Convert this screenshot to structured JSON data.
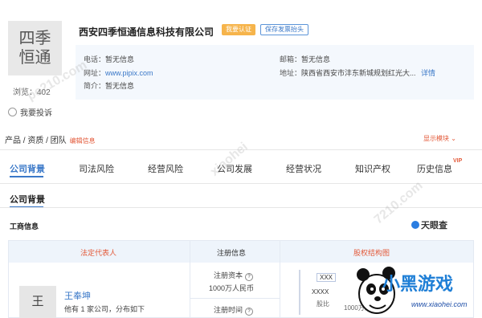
{
  "company": {
    "logo_text_line1": "四季",
    "logo_text_line2": "恒通",
    "name": "西安四季恒通信息科技有限公司",
    "cert_button": "我要认证",
    "save_invoice_button": "保存发票抬头",
    "views_label": "浏览：",
    "views_count": "402",
    "report_label": "我要投诉"
  },
  "info": {
    "phone_label": "电话：",
    "phone_value": "暂无信息",
    "email_label": "邮箱：",
    "email_value": "暂无信息",
    "website_label": "网址：",
    "website_value": "www.pipix.com",
    "address_label": "地址：",
    "address_value": "陕西省西安市沣东新城规划红光大...",
    "address_more": "详情",
    "intro_label": "简介：",
    "intro_value": "暂无信息"
  },
  "products": {
    "label": "产品 / 资质 / 团队",
    "edit": "编辑信息",
    "show_modules": "显示模块"
  },
  "tabs": [
    "公司背景",
    "司法风险",
    "经营风险",
    "公司发展",
    "经营状况",
    "知识产权",
    "历史信息"
  ],
  "vip_badge": "VIP",
  "section": {
    "title": "公司背景",
    "business_info": "工商信息",
    "source_brand": "天眼查"
  },
  "table": {
    "headers": [
      "法定代表人",
      "注册信息",
      "股权结构图"
    ],
    "rep_avatar": "王",
    "rep_name": "王奉坤",
    "rep_desc": "他有 1 家公司，分布如下",
    "reg_capital_label": "注册资本",
    "reg_capital_value": "1000万人民币",
    "reg_time_label": "注册时间",
    "equity_top": "XXX",
    "equity_mid": "XXXX",
    "equity_percent_label": "股比",
    "equity_amount": "1000万人民"
  },
  "watermark": {
    "brand": "小黑游戏",
    "url": "www.xiaohei.com",
    "mid_text": "xiaohei",
    "site": "7210.com",
    "site2": "pc210.com"
  },
  "colors": {
    "accent": "#3a78c8",
    "warn": "#e35a3a",
    "cert": "#f6b44b"
  }
}
